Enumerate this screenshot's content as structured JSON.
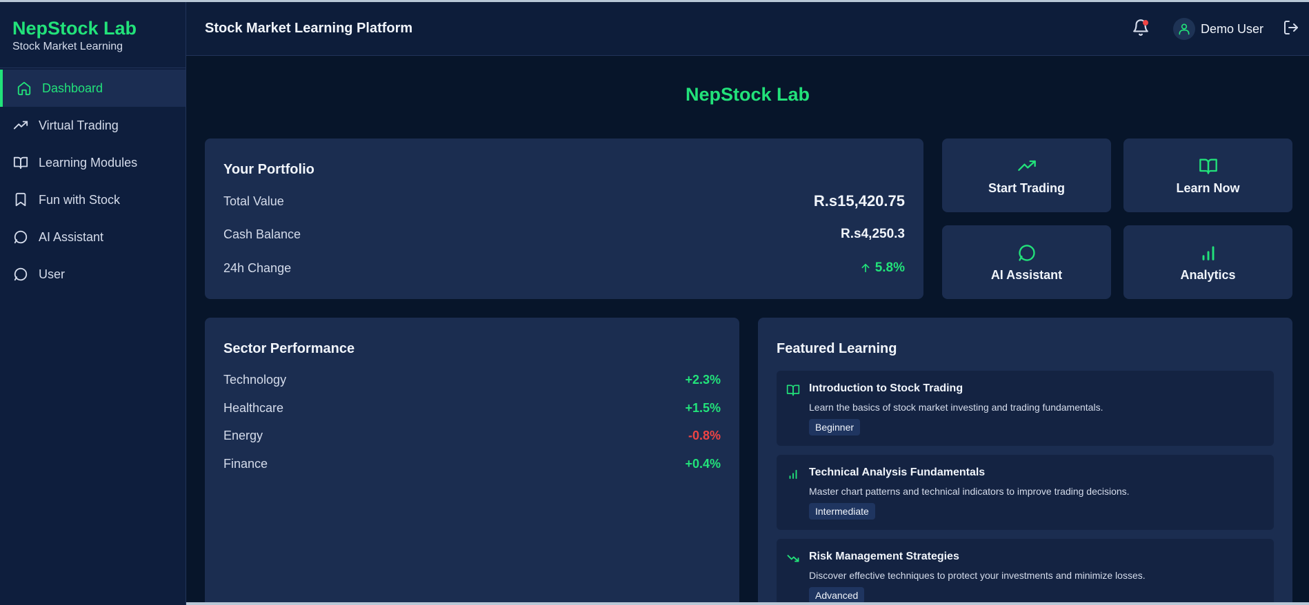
{
  "brand": {
    "title": "NepStock Lab",
    "subtitle": "Stock Market Learning"
  },
  "sidebar": {
    "items": [
      {
        "label": "Dashboard",
        "icon": "home-icon",
        "active": true
      },
      {
        "label": "Virtual Trading",
        "icon": "trending-up-icon",
        "active": false
      },
      {
        "label": "Learning Modules",
        "icon": "book-icon",
        "active": false
      },
      {
        "label": "Fun with Stock",
        "icon": "bookmark-icon",
        "active": false
      },
      {
        "label": "AI Assistant",
        "icon": "chat-icon",
        "active": false
      },
      {
        "label": "User",
        "icon": "chat-icon",
        "active": false
      }
    ]
  },
  "header": {
    "title": "Stock Market Learning Platform",
    "user_name": "Demo User",
    "icons": [
      "bell-icon",
      "user-icon",
      "logout-icon"
    ]
  },
  "main": {
    "title": "NepStock Lab"
  },
  "portfolio": {
    "title": "Your Portfolio",
    "rows": [
      {
        "label": "Total Value",
        "value": "R.s15,420.75"
      },
      {
        "label": "Cash Balance",
        "value": "R.s4,250.3"
      },
      {
        "label": "24h Change",
        "value": "5.8%",
        "direction": "up"
      }
    ]
  },
  "actions": [
    {
      "label": "Start Trading",
      "icon": "trending-up-icon"
    },
    {
      "label": "Learn Now",
      "icon": "book-icon"
    },
    {
      "label": "AI Assistant",
      "icon": "chat-icon"
    },
    {
      "label": "Analytics",
      "icon": "bar-chart-icon"
    }
  ],
  "sectors": {
    "title": "Sector Performance",
    "rows": [
      {
        "name": "Technology",
        "change": "+2.3%"
      },
      {
        "name": "Healthcare",
        "change": "+1.5%"
      },
      {
        "name": "Energy",
        "change": "-0.8%"
      },
      {
        "name": "Finance",
        "change": "+0.4%"
      }
    ]
  },
  "featured": {
    "title": "Featured Learning",
    "courses": [
      {
        "title": "Introduction to Stock Trading",
        "description": "Learn the basics of stock market investing and trading fundamentals.",
        "level": "Beginner",
        "icon": "book-icon"
      },
      {
        "title": "Technical Analysis Fundamentals",
        "description": "Master chart patterns and technical indicators to improve trading decisions.",
        "level": "Intermediate",
        "icon": "bar-chart-icon"
      },
      {
        "title": "Risk Management Strategies",
        "description": "Discover effective techniques to protect your investments and minimize losses.",
        "level": "Advanced",
        "icon": "trending-down-icon"
      }
    ]
  },
  "colors": {
    "accent": "#22e27a",
    "negative": "#ef4444",
    "card": "#1b2d50",
    "background": "#07152a"
  }
}
